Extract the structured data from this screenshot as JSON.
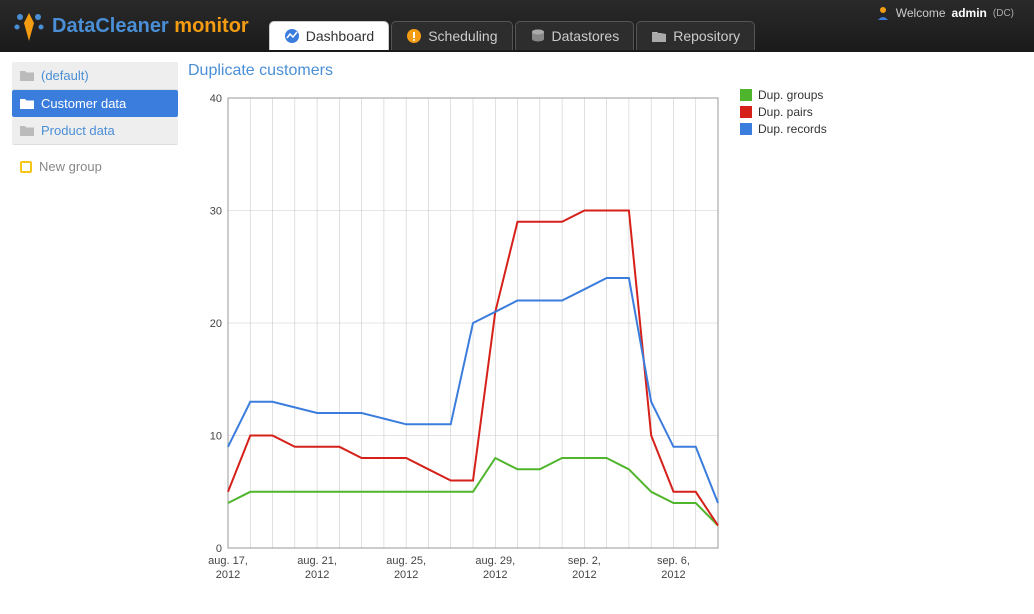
{
  "app": {
    "brand1": "DataCleaner",
    "brand2": "monitor"
  },
  "welcome": {
    "prefix": "Welcome",
    "user": "admin",
    "org": "(DC)"
  },
  "nav": {
    "items": [
      {
        "label": "Dashboard",
        "icon": "dashboard-icon",
        "active": true
      },
      {
        "label": "Scheduling",
        "icon": "scheduling-icon",
        "active": false
      },
      {
        "label": "Datastores",
        "icon": "datastores-icon",
        "active": false
      },
      {
        "label": "Repository",
        "icon": "repository-icon",
        "active": false
      }
    ]
  },
  "sidebar": {
    "items": [
      {
        "label": "(default)",
        "active": false
      },
      {
        "label": "Customer data",
        "active": true
      },
      {
        "label": "Product data",
        "active": false
      }
    ],
    "new_label": "New group"
  },
  "chart_title": "Duplicate customers",
  "colors": {
    "groups": "#4fb52c",
    "pairs": "#d6201a",
    "records": "#3b7ddd",
    "grid": "#ccc",
    "axis": "#999"
  },
  "legend": {
    "items": [
      {
        "key": "groups",
        "label": "Dup. groups"
      },
      {
        "key": "pairs",
        "label": "Dup. pairs"
      },
      {
        "key": "records",
        "label": "Dup. records"
      }
    ]
  },
  "chart_data": {
    "type": "line",
    "title": "Duplicate customers",
    "xlabel": "",
    "ylabel": "",
    "ylim": [
      0,
      40
    ],
    "y_ticks": [
      0,
      10,
      20,
      30,
      40
    ],
    "x_tick_labels": [
      "aug. 17, 2012",
      "aug. 21, 2012",
      "aug. 25, 2012",
      "aug. 29, 2012",
      "sep. 2, 2012",
      "sep. 6, 2012"
    ],
    "x_tick_indices": [
      0,
      4,
      8,
      12,
      16,
      20
    ],
    "n_points": 23,
    "series": [
      {
        "name": "Dup. groups",
        "color_key": "groups",
        "values": [
          4,
          5,
          5,
          5,
          5,
          5,
          5,
          5,
          5,
          5,
          5,
          5,
          8,
          7,
          7,
          8,
          8,
          8,
          7,
          5,
          4,
          4,
          2
        ]
      },
      {
        "name": "Dup. pairs",
        "color_key": "pairs",
        "values": [
          5,
          10,
          10,
          9,
          9,
          9,
          8,
          8,
          8,
          7,
          6,
          6,
          21,
          29,
          29,
          29,
          30,
          30,
          30,
          10,
          5,
          5,
          2
        ]
      },
      {
        "name": "Dup. records",
        "color_key": "records",
        "values": [
          9,
          13,
          13,
          12.5,
          12,
          12,
          12,
          11.5,
          11,
          11,
          11,
          20,
          21,
          22,
          22,
          22,
          23,
          24,
          24,
          13,
          9,
          9,
          4
        ]
      }
    ]
  }
}
